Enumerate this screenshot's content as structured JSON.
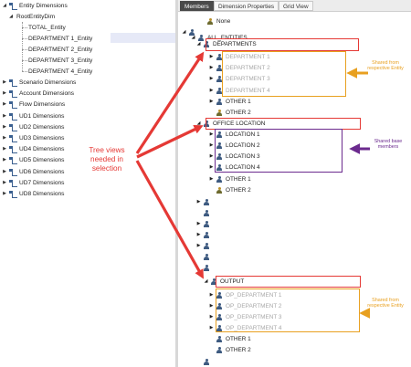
{
  "left_tree": {
    "entity_dimensions": "Entity Dimensions",
    "root_entity_dim": "RootEntityDim",
    "entities": [
      "TOTAL_Entity",
      "DEPARTMENT 1_Entity",
      "DEPARTMENT 2_Entity",
      "DEPARTMENT 3_Entity",
      "DEPARTMENT 4_Entity"
    ],
    "dimensions": [
      "Scenario Dimensions",
      "Account Dimensions",
      "Flow Dimensions",
      "UD1 Dimensions",
      "UD2 Dimensions",
      "UD3 Dimensions",
      "UD4 Dimensions",
      "UD5 Dimensions",
      "UD6 Dimensions",
      "UD7 Dimensions",
      "UD8 Dimensions"
    ]
  },
  "tabs": [
    "Members",
    "Dimension Properties",
    "Grid View"
  ],
  "right_tree": {
    "none": "None",
    "all_entities": "ALL_ENTITIES",
    "departments": "DEPARTMENTS",
    "department_items": [
      "DEPARTMENT 1",
      "DEPARTMENT 2",
      "DEPARTMENT 3",
      "DEPARTMENT 4"
    ],
    "other_1": "OTHER 1",
    "other_2": "OTHER 2",
    "office_location": "OFFICE LOCATION",
    "location_items": [
      "LOCATION 1",
      "LOCATION 2",
      "LOCATION 3",
      "LOCATION 4"
    ],
    "output": "OUTPUT",
    "op_items": [
      "OP_DEPARTMENT 1",
      "OP_DEPARTMENT 2",
      "OP_DEPARTMENT 3",
      "OP_DEPARTMENT 4"
    ]
  },
  "annotations": {
    "tree_views_note": "Tree views needed in selection",
    "shared_entity_top": "Shared from respective Entity",
    "shared_base_members": "Shared base members",
    "shared_entity_bottom": "Shared from respective Entity"
  },
  "colors": {
    "red": "#e53935",
    "orange": "#e8a020",
    "purple": "#6b2a8e",
    "selection": "#e6e9f7"
  }
}
